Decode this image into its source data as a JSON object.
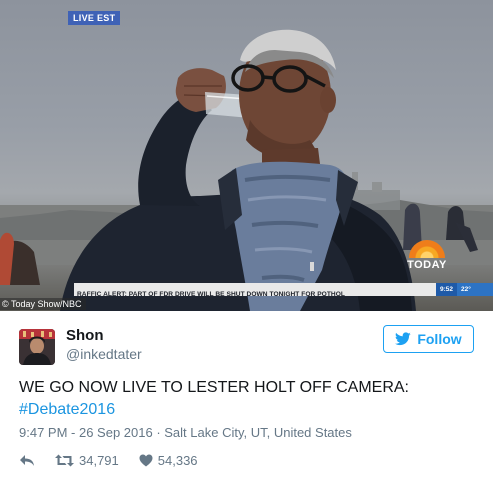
{
  "broadcast": {
    "live_badge": "LIVE EST",
    "network_logo": "TODAY",
    "ticker_text": "RAFFIC ALERT:  PART OF FDR DRIVE WILL BE SHUT DOWN TONIGHT FOR POTHOL",
    "ticker_time": "9:52",
    "ticker_temp": "22°",
    "photo_credit": "© Today Show/NBC"
  },
  "tweet": {
    "display_name": "Shon",
    "handle": "@inkedtater",
    "follow_label": "Follow",
    "text": "WE GO NOW LIVE TO LESTER HOLT OFF CAMERA:",
    "hashtag": "#Debate2016",
    "timestamp": "9:47 PM - 26 Sep 2016 · Salt Lake City, UT, United States",
    "retweets": "34,791",
    "likes": "54,336"
  },
  "colors": {
    "twitter_blue": "#1da1f2",
    "hashtag_blue": "#1b95e0",
    "muted_gray": "#657786",
    "text_dark": "#14171a"
  },
  "icons": [
    "twitter-bird-icon",
    "reply-icon",
    "retweet-icon",
    "heart-icon"
  ]
}
